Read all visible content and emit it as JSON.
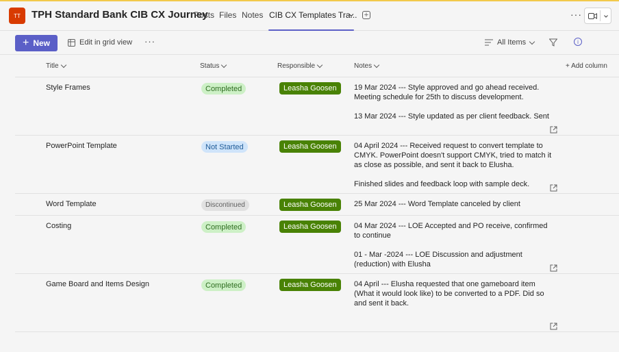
{
  "header": {
    "team_initials": "TT",
    "team_name": "TPH Standard Bank CIB CX Journey",
    "tabs": [
      "Posts",
      "Files",
      "Notes",
      "CIB CX Templates Tra..."
    ],
    "active_tab_index": 3
  },
  "toolbar": {
    "new_label": "New",
    "grid_view_label": "Edit in grid view",
    "view_label": "All Items"
  },
  "columns": {
    "title": "Title",
    "status": "Status",
    "responsible": "Responsible",
    "notes": "Notes",
    "add": "+ Add column"
  },
  "rows": [
    {
      "title": "Style Frames",
      "status": "Completed",
      "responsible": "Leasha Goosen",
      "notes_1": "19 Mar 2024 --- Style approved and go ahead received. Meeting schedule for 25th to discuss development.",
      "notes_2": "13 Mar 2024 --- Style updated as per client feedback. Sent"
    },
    {
      "title": "PowerPoint Template",
      "status": "Not Started",
      "responsible": "Leasha Goosen",
      "notes_1": "04 April 2024 --- Received request to convert template to CMYK. PowerPoint doesn't support CMYK, tried to match it as close as possible, and sent it back to Elusha.",
      "notes_2": "Finished slides and feedback loop with sample deck. Elusha"
    },
    {
      "title": "Word Template",
      "status": "Discontinued",
      "responsible": "Leasha Goosen",
      "notes_1": "25 Mar 2024 --- Word Template canceled by client",
      "notes_2": ""
    },
    {
      "title": "Costing",
      "status": "Completed",
      "responsible": "Leasha Goosen",
      "notes_1": "04 Mar 2024 --- LOE Accepted and PO receive, confirmed to continue",
      "notes_2": "01 - Mar -2024 --- LOE Discussion and adjustment (reduction) with Elusha"
    },
    {
      "title": "Game Board and Items Design",
      "status": "Completed",
      "responsible": "Leasha Goosen",
      "notes_1": "04 April --- Elusha requested that one gameboard item (What it would look like) to be converted to a PDF. Did so and sent it back.",
      "notes_2": ""
    }
  ],
  "colors": {
    "accent": "#5b5fc7",
    "person_pill": "#498205",
    "completed_bg": "#cdf0c6",
    "notstarted_bg": "#cfe4fa",
    "discontinued_bg": "#e1e1e1",
    "team_avatar": "#d83b01"
  }
}
